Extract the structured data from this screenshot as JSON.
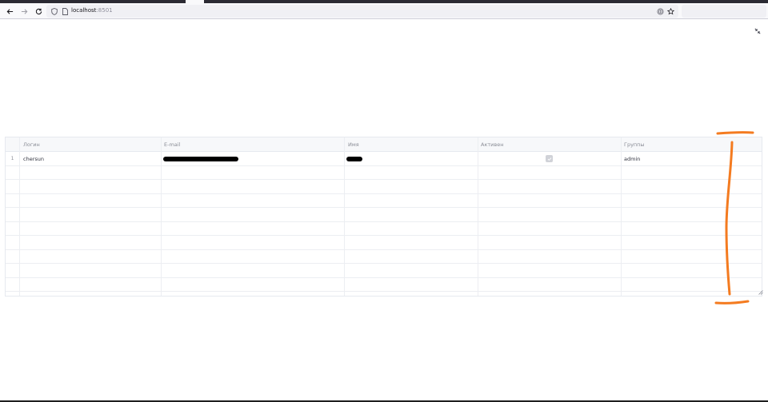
{
  "browser": {
    "url_host": "localhost",
    "url_port": ":8501",
    "nav": {
      "back_icon": "arrow-left-icon",
      "forward_icon": "arrow-right-icon",
      "reload_icon": "reload-icon"
    }
  },
  "table": {
    "columns": [
      "Логин",
      "E-mail",
      "Имя",
      "Активен",
      "Группы"
    ],
    "rows": [
      {
        "index": "1",
        "login": "chersun",
        "email": "",
        "name": "",
        "active": true,
        "groups": "admin"
      }
    ],
    "empty_rows": 9
  },
  "colors": {
    "annotation": "#f47b20",
    "checkbox_checked": "#d0d2d8",
    "header_bg": "#f7f8fa"
  }
}
